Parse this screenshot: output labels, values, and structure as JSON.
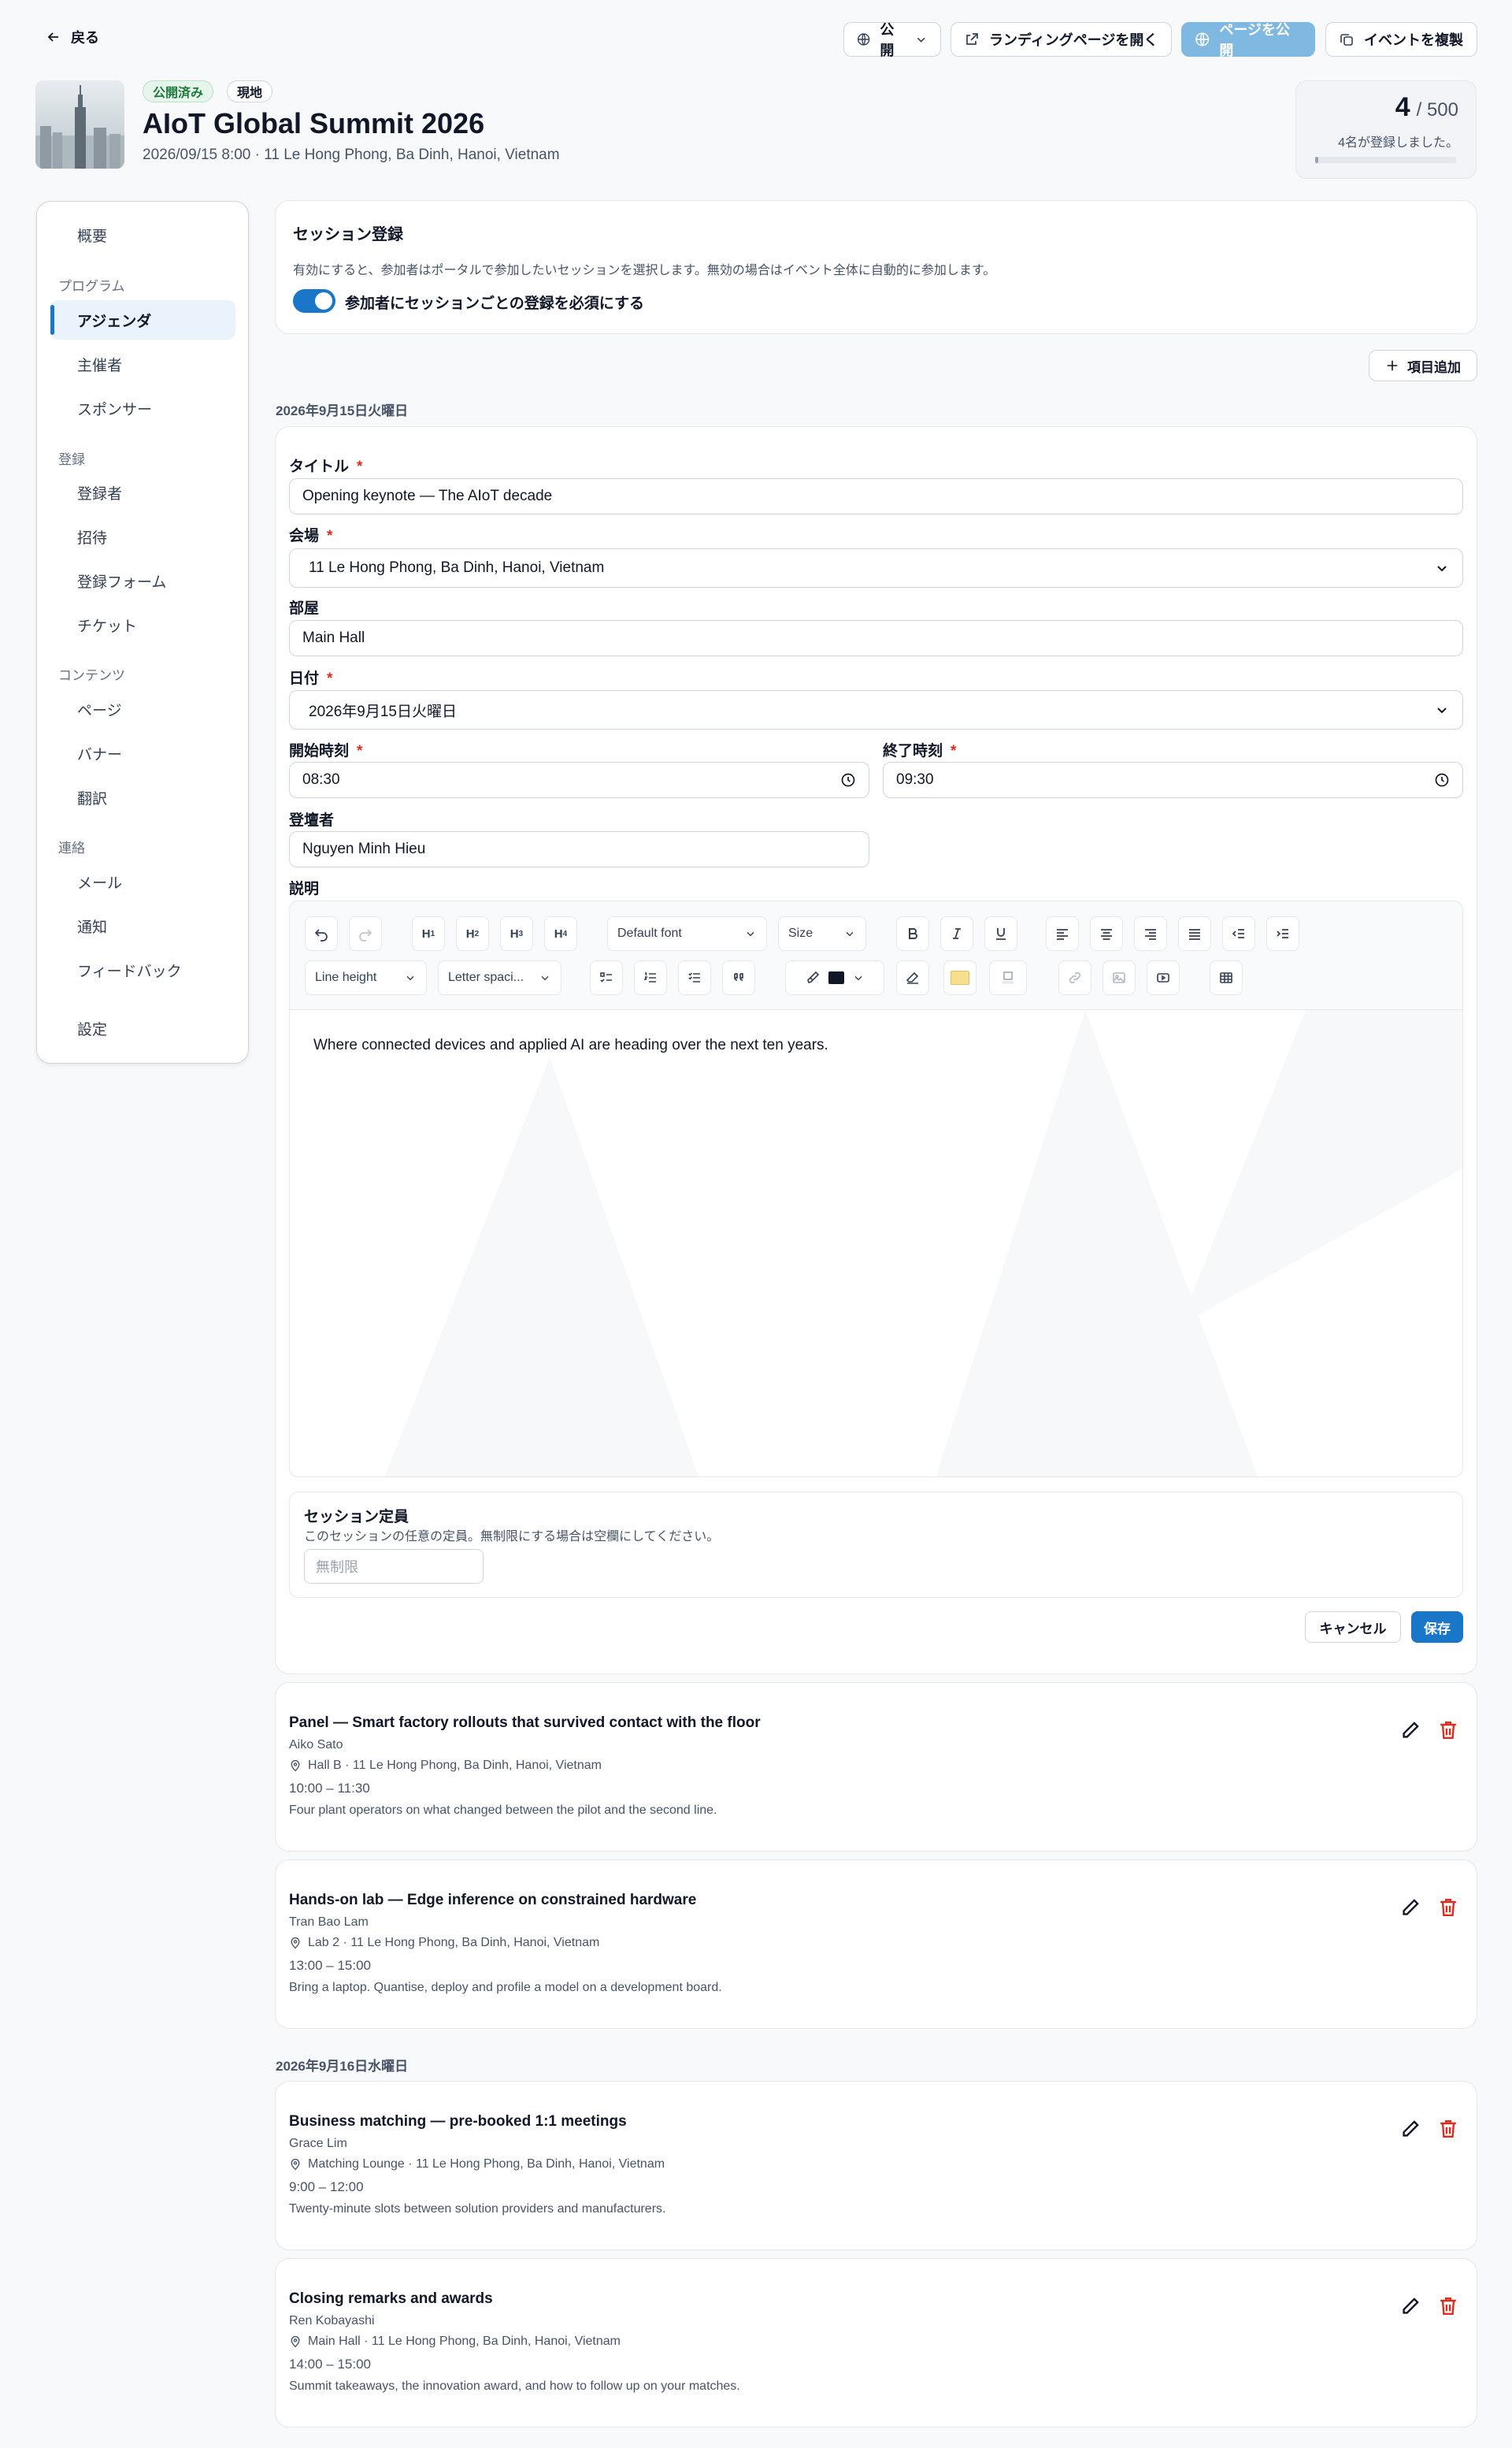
{
  "header": {
    "back_label": "戻る",
    "visibility_label": "公開",
    "open_landing_label": "ランディングページを開く",
    "publish_label": "ページを公開",
    "duplicate_label": "イベントを複製"
  },
  "event": {
    "status_badge": "公開済み",
    "type_badge": "現地",
    "title": "AIoT Global Summit 2026",
    "meta": "2026/09/15 8:00 · 11 Le Hong Phong, Ba Dinh, Hanoi, Vietnam"
  },
  "registrations": {
    "count": "4",
    "capacity": "/ 500",
    "note": "4名が登録しました。",
    "progress_fraction": 0.008
  },
  "sidebar": {
    "overview": "概要",
    "sections": [
      {
        "title": "プログラム",
        "items": [
          "アジェンダ",
          "主催者",
          "スポンサー"
        ]
      },
      {
        "title": "登録",
        "items": [
          "登録者",
          "招待",
          "登録フォーム",
          "チケット"
        ]
      },
      {
        "title": "コンテンツ",
        "items": [
          "ページ",
          "バナー",
          "翻訳"
        ]
      },
      {
        "title": "連絡",
        "items": [
          "メール",
          "通知",
          "フィードバック"
        ]
      }
    ],
    "settings": "設定",
    "active_item": "アジェンダ"
  },
  "session_registration": {
    "title": "セッション登録",
    "description": "有効にすると、参加者はポータルで参加したいセッションを選択します。無効の場合はイベント全体に自動的に参加します。",
    "toggle_label": "参加者にセッションごとの登録を必須にする",
    "toggle_on": true
  },
  "add_item_label": "項目追加",
  "days": [
    {
      "label": "2026年9月15日火曜日"
    },
    {
      "label": "2026年9月16日水曜日"
    }
  ],
  "form": {
    "title_label": "タイトル",
    "title_value": "Opening keynote — The AIoT decade",
    "venue_label": "会場",
    "venue_value": "11 Le Hong Phong, Ba Dinh, Hanoi, Vietnam",
    "room_label": "部屋",
    "room_value": "Main Hall",
    "date_label": "日付",
    "date_value": "2026年9月15日火曜日",
    "start_label": "開始時刻",
    "start_value": "08:30",
    "end_label": "終了時刻",
    "end_value": "09:30",
    "speaker_label": "登壇者",
    "speaker_value": "Nguyen Minh Hieu",
    "description_label": "説明",
    "toolbar": {
      "font": "Default font",
      "size": "Size",
      "line_height": "Line height",
      "letter_spacing": "Letter spaci...",
      "text_color": "#101828",
      "highlight_color": "#f6e08f"
    },
    "description_value": "Where connected devices and applied AI are heading over the next ten years.",
    "capacity_title": "セッション定員",
    "capacity_help": "このセッションの任意の定員。無制限にする場合は空欄にしてください。",
    "capacity_placeholder": "無制限",
    "cancel_label": "キャンセル",
    "save_label": "保存"
  },
  "sessions": [
    {
      "title": "Panel — Smart factory rollouts that survived contact with the floor",
      "speaker": "Aiko Sato",
      "location": "Hall B · 11 Le Hong Phong, Ba Dinh, Hanoi, Vietnam",
      "time": "10:00 – 11:30",
      "description": "Four plant operators on what changed between the pilot and the second line."
    },
    {
      "title": "Hands-on lab — Edge inference on constrained hardware",
      "speaker": "Tran Bao Lam",
      "location": "Lab 2 · 11 Le Hong Phong, Ba Dinh, Hanoi, Vietnam",
      "time": "13:00 – 15:00",
      "description": "Bring a laptop. Quantise, deploy and profile a model on a development board."
    },
    {
      "title": "Business matching — pre-booked 1:1 meetings",
      "speaker": "Grace Lim",
      "location": "Matching Lounge · 11 Le Hong Phong, Ba Dinh, Hanoi, Vietnam",
      "time": "9:00 – 12:00",
      "description": "Twenty-minute slots between solution providers and manufacturers."
    },
    {
      "title": "Closing remarks and awards",
      "speaker": "Ren Kobayashi",
      "location": "Main Hall · 11 Le Hong Phong, Ba Dinh, Hanoi, Vietnam",
      "time": "14:00 – 15:00",
      "description": "Summit takeaways, the innovation award, and how to follow up on your matches."
    }
  ],
  "colors": {
    "accent": "#1976c8",
    "publish_disabled": "#7fb8e0",
    "success_bg": "#e7f6ec",
    "success_text": "#1e7a3c",
    "danger": "#d92d20"
  }
}
